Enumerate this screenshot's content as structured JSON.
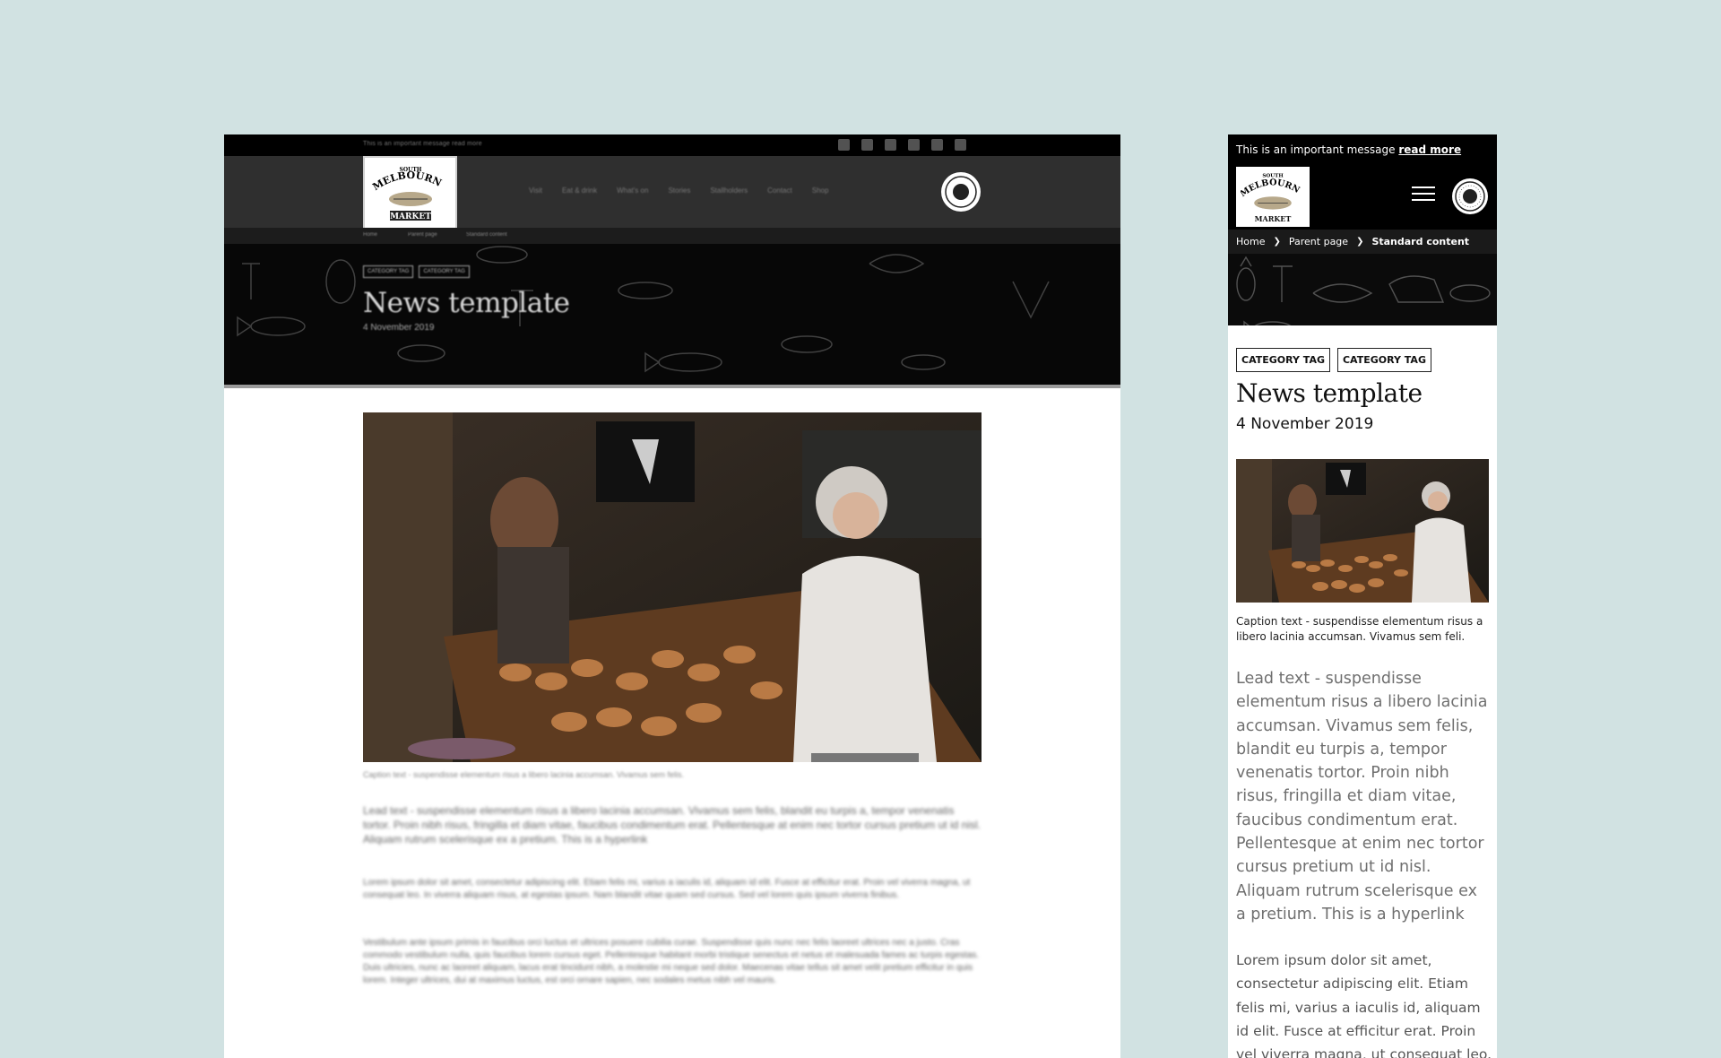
{
  "desktop": {
    "message": "This is an important message read more",
    "social_icons": [
      "facebook-icon",
      "instagram-icon",
      "twitter-icon",
      "youtube-icon",
      "linkedin-icon",
      "email-icon"
    ],
    "nav": [
      "Visit",
      "Eat & drink",
      "What's on",
      "Stories",
      "Stallholders",
      "Contact",
      "Shop"
    ],
    "breadcrumbs": [
      "Home",
      "Parent page",
      "Standard content"
    ],
    "tags": [
      "CATEGORY TAG",
      "CATEGORY TAG"
    ],
    "title": "News template",
    "date": "4 November 2019",
    "caption": "Caption text - suspendisse elementum risus a libero lacinia accumsan. Vivamus sem felis.",
    "lead": "Lead text - suspendisse elementum risus a libero lacinia accumsan. Vivamus sem felis, blandit eu turpis a, tempor venenatis tortor. Proin nibh risus, fringilla et diam vitae, faucibus condimentum erat. Pellentesque at enim nec tortor cursus pretium ut id nisl. Aliquam rutrum scelerisque ex a pretium. This is a hyperlink",
    "body1": "Lorem ipsum dolor sit amet, consectetur adipiscing elit. Etiam felis mi, varius a iaculis id, aliquam id elit. Fusce at efficitur erat. Proin vel viverra magna, ut consequat leo. In viverra aliquam risus, at egestas ipsum. Nam blandit vitae quam sed cursus. Sed vel lorem quis ipsum viverra finibus.",
    "body2": "Vestibulum ante ipsum primis in faucibus orci luctus et ultrices posuere cubilia curae. Suspendisse quis nunc nec felis laoreet ultrices nec a justo. Cras commodo vestibulum nulla, quis faucibus lorem cursus eget. Pellentesque habitant morbi tristique senectus et netus et malesuada fames ac turpis egestas. Duis ultricies, nunc ac laoreet aliquam, lacus erat tincidunt nibh, a molestie mi neque sed dolor. Maecenas vitae tellus sit amet velit pretium efficitur in quis lorem. Integer ultrices, dui at maximus luctus, est orci ornare sapien, nec sodales metus nibh vel mauris."
  },
  "mobile": {
    "message_text": "This is an important message",
    "message_link": "read more",
    "breadcrumbs": [
      "Home",
      "Parent page",
      "Standard content"
    ],
    "tags": [
      "CATEGORY TAG",
      "CATEGORY TAG"
    ],
    "title": "News template",
    "date": "4 November 2019",
    "caption": "Caption text - suspendisse elementum risus a libero lacinia accumsan. Vivamus sem feli.",
    "lead": "Lead text - suspendisse elementum risus a libero lacinia accumsan. Vivamus sem felis, blandit eu turpis a, tempor venenatis tortor. Proin nibh risus, fringilla et diam vitae, faucibus condimentum erat. Pellentesque at enim nec tortor cursus pretium ut id nisl. Aliquam rutrum scelerisque ex a pretium. This is a hyperlink",
    "body": "Lorem ipsum dolor sit amet, consectetur adipiscing elit. Etiam felis mi, varius a iaculis id, aliquam id elit. Fusce at efficitur erat. Proin vel viverra magna, ut consequat leo. In"
  },
  "logo": {
    "line1": "SOUTH",
    "line2": "MELBOURNE",
    "line3": "MARKET"
  },
  "colors": {
    "background": "#d1e2e2",
    "header": "#000000",
    "nav": "#2f2f2f"
  }
}
